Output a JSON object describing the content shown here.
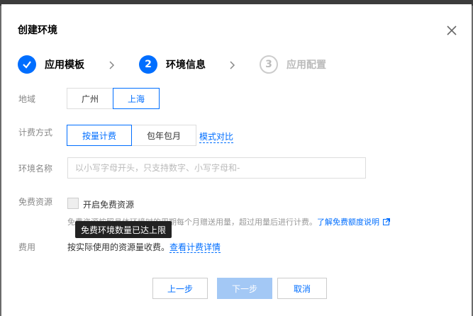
{
  "dialog": {
    "title": "创建环境"
  },
  "steps": [
    {
      "number": "✓",
      "label": "应用模板",
      "state": "done"
    },
    {
      "number": "2",
      "label": "环境信息",
      "state": "active"
    },
    {
      "number": "3",
      "label": "应用配置",
      "state": "pending"
    }
  ],
  "form": {
    "region": {
      "label": "地域",
      "options": [
        "广州",
        "上海"
      ],
      "selected": "上海"
    },
    "billing": {
      "label": "计费方式",
      "options": [
        "按量计费",
        "包年包月"
      ],
      "selected": "按量计费",
      "compare_link": "模式对比"
    },
    "env_name": {
      "label": "环境名称",
      "value": "",
      "placeholder": "以小写字母开头，只支持数字、小写字母和-"
    },
    "free_resource": {
      "label": "免费资源",
      "checkbox_label": "开启免费资源",
      "checked": false,
      "help_text": "免费资源按照具体环境时的周期每个月赠送用量，超过用量后进行计费。",
      "help_link": "了解免费额度说明",
      "tooltip": "免费环境数量已达上限"
    },
    "fee": {
      "label": "费用",
      "text": "按实际使用的资源量收费。",
      "link": "查看计费详情"
    }
  },
  "footer": {
    "prev_label": "上一步",
    "next_label": "下一步",
    "cancel_label": "取消"
  },
  "colors": {
    "accent": "#006eff",
    "disabled_primary": "#a3c8f5"
  }
}
